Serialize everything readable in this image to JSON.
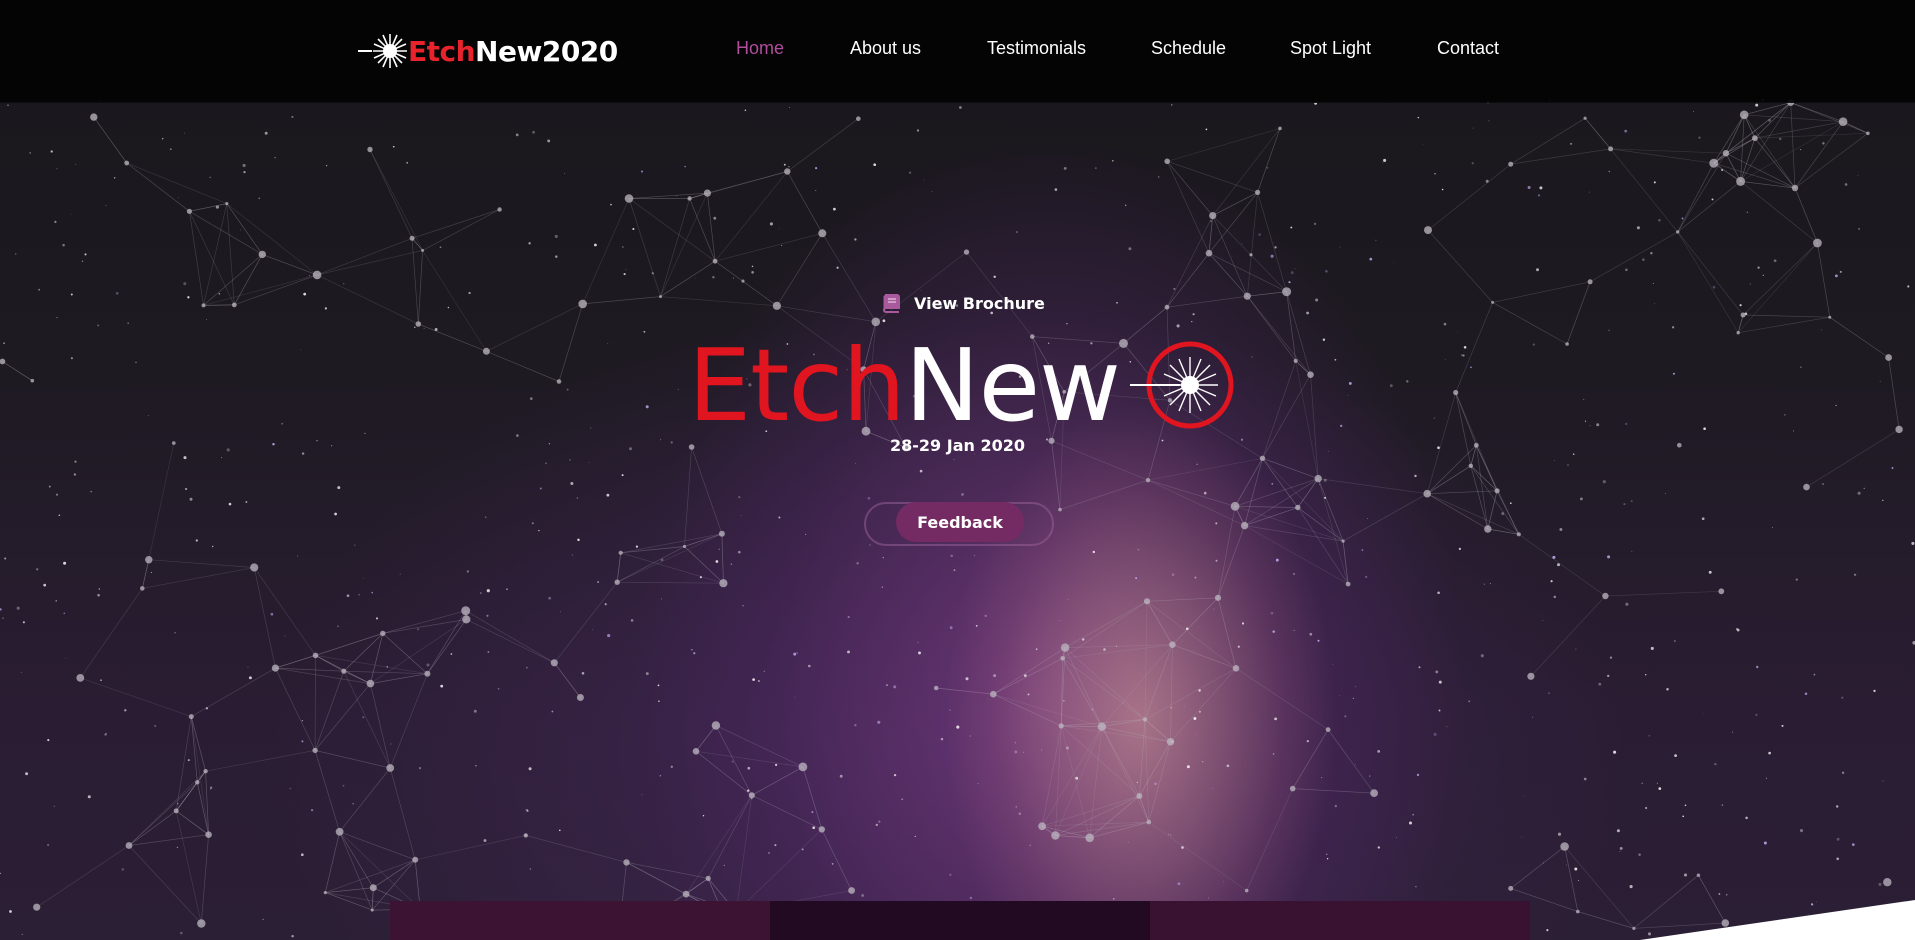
{
  "brand": {
    "name_red": "Etch",
    "name_white": "New2020",
    "logo_icon": "laser-burst-icon"
  },
  "nav": {
    "items": [
      {
        "label": "Home",
        "active": true
      },
      {
        "label": "About us",
        "active": false
      },
      {
        "label": "Testimonials",
        "active": false
      },
      {
        "label": "Schedule",
        "active": false
      },
      {
        "label": "Spot Light",
        "active": false
      },
      {
        "label": "Contact",
        "active": false
      }
    ]
  },
  "hero": {
    "brochure": {
      "label": "View Brochure",
      "icon": "book-icon"
    },
    "title_red": "Etch",
    "title_white": "New",
    "title_icon": "laser-circle-icon",
    "date": "28-29 Jan 2020",
    "feedback_label": "Feedback"
  },
  "colors": {
    "accent_red": "#e0151f",
    "accent_purple": "#742b63",
    "nav_active": "#b04d9c",
    "navbar_bg": "#030303"
  }
}
